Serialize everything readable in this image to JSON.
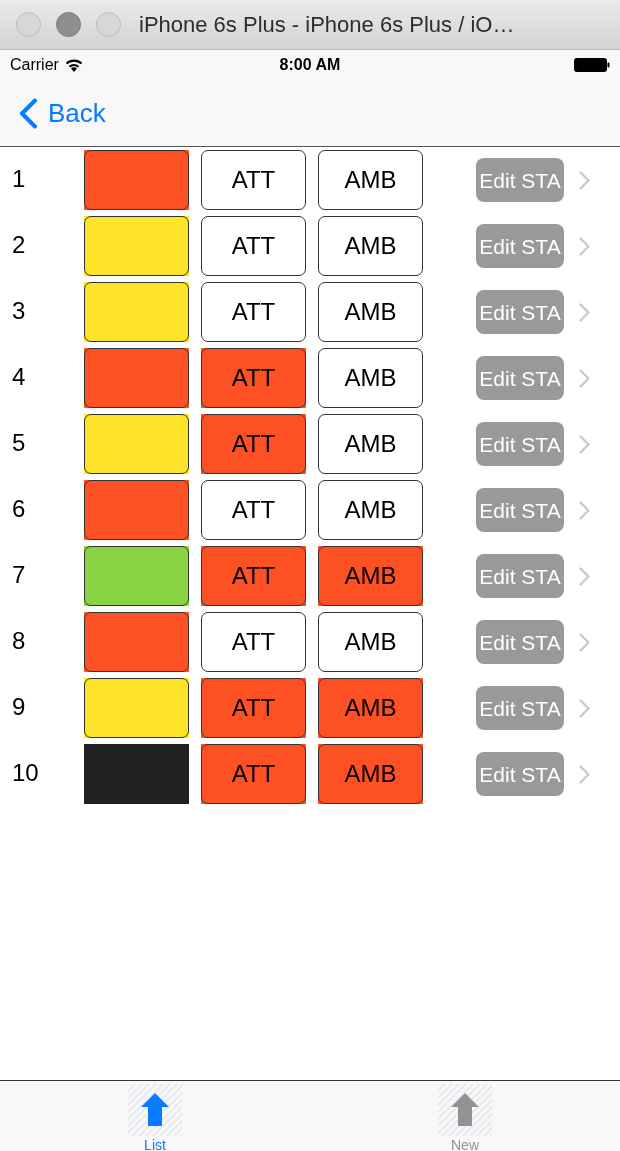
{
  "window": {
    "title": "iPhone 6s Plus - iPhone 6s Plus / iO…"
  },
  "status_bar": {
    "carrier": "Carrier",
    "time": "8:00 AM"
  },
  "nav_bar": {
    "back": "Back"
  },
  "rows": [
    {
      "number": "1",
      "status": {
        "color": "#fe5123",
        "bordered": true
      },
      "att": {
        "label": "ATT",
        "active": false
      },
      "amb": {
        "label": "AMB",
        "active": false
      },
      "edit": "Edit STA"
    },
    {
      "number": "2",
      "status": {
        "color": "#fde428",
        "bordered": true
      },
      "att": {
        "label": "ATT",
        "active": false
      },
      "amb": {
        "label": "AMB",
        "active": false
      },
      "edit": "Edit STA"
    },
    {
      "number": "3",
      "status": {
        "color": "#fde428",
        "bordered": true
      },
      "att": {
        "label": "ATT",
        "active": false
      },
      "amb": {
        "label": "AMB",
        "active": false
      },
      "edit": "Edit STA"
    },
    {
      "number": "4",
      "status": {
        "color": "#fe5123",
        "bordered": true
      },
      "att": {
        "label": "ATT",
        "active": true
      },
      "amb": {
        "label": "AMB",
        "active": false
      },
      "edit": "Edit STA"
    },
    {
      "number": "5",
      "status": {
        "color": "#fde428",
        "bordered": true
      },
      "att": {
        "label": "ATT",
        "active": true
      },
      "amb": {
        "label": "AMB",
        "active": false
      },
      "edit": "Edit STA"
    },
    {
      "number": "6",
      "status": {
        "color": "#fe5123",
        "bordered": true
      },
      "att": {
        "label": "ATT",
        "active": false
      },
      "amb": {
        "label": "AMB",
        "active": false
      },
      "edit": "Edit STA"
    },
    {
      "number": "7",
      "status": {
        "color": "#88d443",
        "bordered": true
      },
      "att": {
        "label": "ATT",
        "active": true
      },
      "amb": {
        "label": "AMB",
        "active": true
      },
      "edit": "Edit STA"
    },
    {
      "number": "8",
      "status": {
        "color": "#fe5123",
        "bordered": true
      },
      "att": {
        "label": "ATT",
        "active": false
      },
      "amb": {
        "label": "AMB",
        "active": false
      },
      "edit": "Edit STA"
    },
    {
      "number": "9",
      "status": {
        "color": "#fde428",
        "bordered": true
      },
      "att": {
        "label": "ATT",
        "active": true
      },
      "amb": {
        "label": "AMB",
        "active": true
      },
      "edit": "Edit STA"
    },
    {
      "number": "10",
      "status": {
        "color": "#212121",
        "bordered": false
      },
      "att": {
        "label": "ATT",
        "active": true
      },
      "amb": {
        "label": "AMB",
        "active": true
      },
      "edit": "Edit STA"
    }
  ],
  "tab_bar": {
    "items": [
      {
        "label": "List",
        "selected": true
      },
      {
        "label": "New",
        "selected": false
      }
    ]
  }
}
